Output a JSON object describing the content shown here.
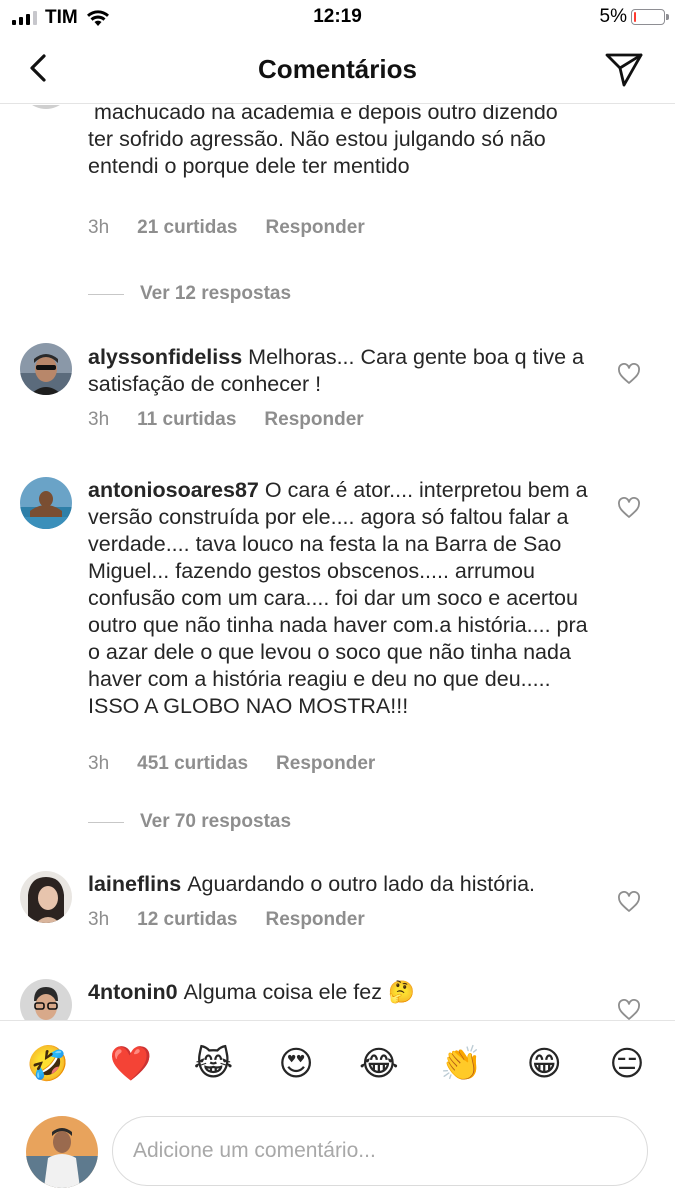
{
  "status_bar": {
    "carrier": "TIM",
    "time": "12:19",
    "battery": "5%",
    "battery_level": 0.05
  },
  "header": {
    "title": "Comentários"
  },
  "comments": [
    {
      "user": "",
      "text": "machucado na academia e depois outro dizendo ter sofrido agressão. Não estou julgando só não entendi o porque dele ter mentido",
      "time": "3h",
      "likes": "21 curtidas",
      "reply": "Responder",
      "view_replies": "Ver 12 respostas"
    },
    {
      "user": "alyssonfideliss",
      "text": "Melhoras... Cara gente boa q tive a satisfação de conhecer !",
      "time": "3h",
      "likes": "11 curtidas",
      "reply": "Responder"
    },
    {
      "user": "antoniosoares87",
      "text": "O cara é ator.... interpretou bem a versão construída por ele.... agora só faltou falar a verdade.... tava louco na festa la na Barra de Sao Miguel... fazendo gestos obscenos..... arrumou confusão com um cara.... foi dar um soco e acertou outro que não tinha nada haver com.a história.... pra o azar dele o que levou o soco que não tinha nada haver com a história reagiu e deu no que deu..... ISSO A GLOBO NAO MOSTRA!!!",
      "time": "3h",
      "likes": "451 curtidas",
      "reply": "Responder",
      "view_replies": "Ver 70 respostas"
    },
    {
      "user": "laineflins",
      "text": "Aguardando o outro lado da história.",
      "time": "3h",
      "likes": "12 curtidas",
      "reply": "Responder"
    },
    {
      "user": "4ntonin0",
      "text": "Alguma coisa ele fez 🤔"
    }
  ],
  "emoji_bar": [
    "🤣",
    "❤️",
    "😹",
    "😍",
    "😂",
    "👏",
    "😁",
    "😑"
  ],
  "input": {
    "placeholder": "Adicione um comentário..."
  }
}
